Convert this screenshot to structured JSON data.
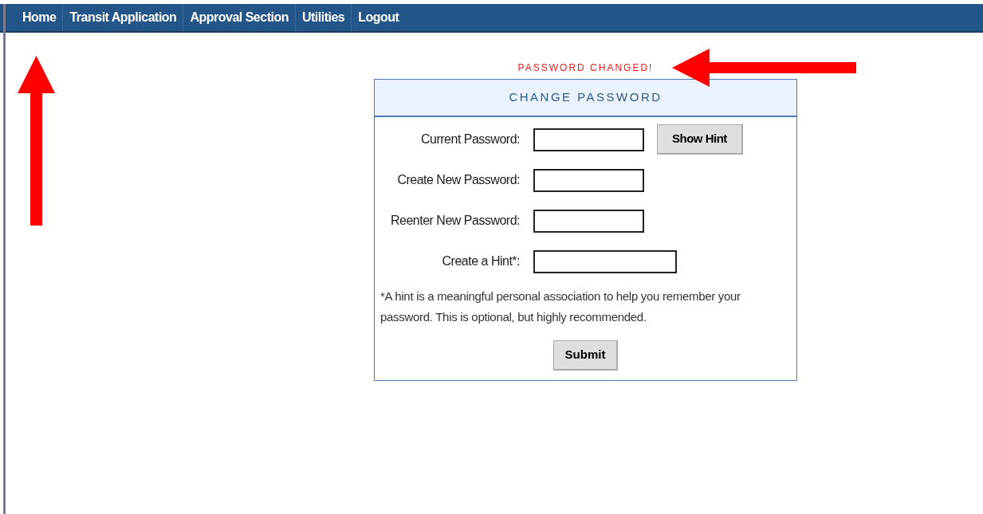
{
  "nav": [
    {
      "label": "Home"
    },
    {
      "label": "Transit Application"
    },
    {
      "label": "Approval Section"
    },
    {
      "label": "Utilities"
    },
    {
      "label": "Logout"
    }
  ],
  "message": "PASSWORD CHANGED!",
  "form": {
    "title": "CHANGE PASSWORD",
    "fields": [
      {
        "label": "Current Password:",
        "kind": "password",
        "button": "Show Hint"
      },
      {
        "label": "Create New Password:",
        "kind": "password"
      },
      {
        "label": "Reenter New Password:",
        "kind": "password"
      },
      {
        "label": "Create a Hint*:",
        "kind": "hint"
      }
    ],
    "note": "*A hint is a meaningful personal association to help you remember your password. This is optional, but highly recommended.",
    "submit": "Submit"
  }
}
